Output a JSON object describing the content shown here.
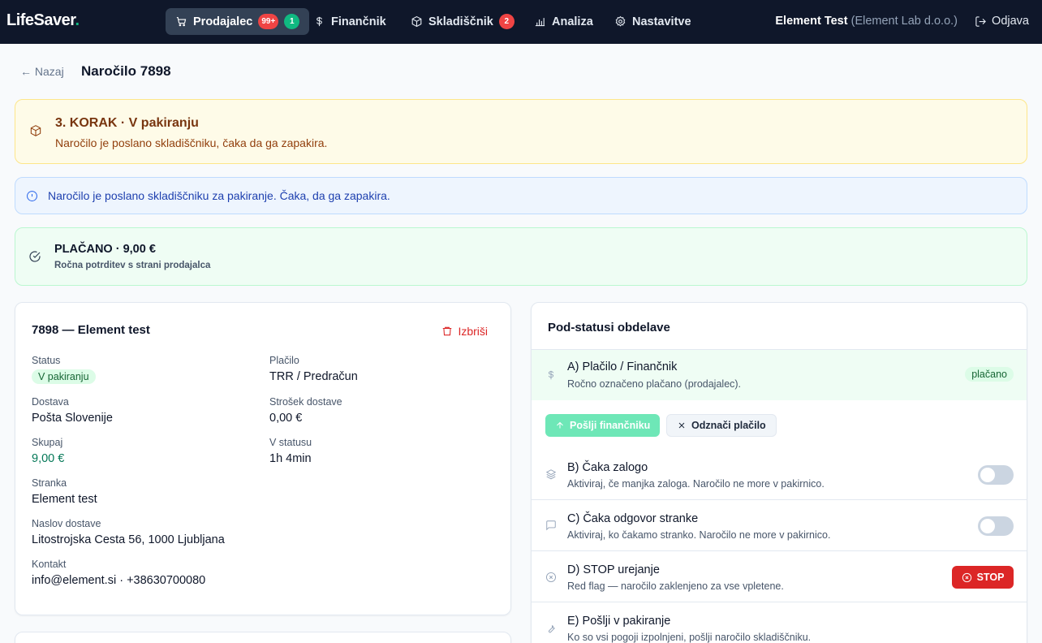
{
  "app": {
    "logo": "LifeSaver",
    "logo_dot": "."
  },
  "nav": {
    "items": [
      {
        "label": "Prodajalec",
        "badge_red": "99+",
        "badge_green": "1"
      },
      {
        "label": "Finančnik"
      },
      {
        "label": "Skladiščnik",
        "badge_red": "2"
      },
      {
        "label": "Analiza"
      },
      {
        "label": "Nastavitve"
      }
    ],
    "user": "Element Test",
    "org": "(Element Lab d.o.o.)",
    "logout": "Odjava"
  },
  "header": {
    "back": "← Nazaj",
    "title": "Naročilo 7898"
  },
  "step_banner": {
    "title": "3. KORAK · V pakiranju",
    "subtitle": "Naročilo je poslano skladiščniku, čaka da ga zapakira."
  },
  "info_banner": {
    "text": "Naročilo je poslano skladiščniku za pakiranje. Čaka, da ga zapakira."
  },
  "paid_banner": {
    "title": "PLAČANO · 9,00 €",
    "subtitle": "Ročna potrditev s strani prodajalca"
  },
  "order": {
    "heading": "7898 — Element test",
    "delete": "Izbriši",
    "status_label": "Status",
    "status_value": "V pakiranju",
    "payment_label": "Plačilo",
    "payment_value": "TRR / Predračun",
    "delivery_label": "Dostava",
    "delivery_value": "Pošta Slovenije",
    "delivery_cost_label": "Strošek dostave",
    "delivery_cost_value": "0,00 €",
    "total_label": "Skupaj",
    "total_value": "9,00 €",
    "in_status_label": "V statusu",
    "in_status_value": "1h 4min",
    "customer_label": "Stranka",
    "customer_value": "Element test",
    "address_label": "Naslov dostave",
    "address_value": "Litostrojska Cesta 56, 1000 Ljubljana",
    "contact_label": "Kontakt",
    "contact_value": "info@element.si · +38630700080"
  },
  "substatus": {
    "heading": "Pod-statusi obdelave",
    "a": {
      "title": "A) Plačilo / Finančnik",
      "subtitle": "Ročno označeno plačano (prodajalec).",
      "pill": "plačano",
      "send_btn": "Pošlji finančniku",
      "unmark_btn": "Odznači plačilo"
    },
    "b": {
      "title": "B) Čaka zalogo",
      "subtitle": "Aktiviraj, če manjka zaloga. Naročilo ne more v pakirnico."
    },
    "c": {
      "title": "C) Čaka odgovor stranke",
      "subtitle": "Aktiviraj, ko čakamo stranko. Naročilo ne more v pakirnico."
    },
    "d": {
      "title": "D) STOP urejanje",
      "subtitle": "Red flag — naročilo zaklenjeno za vse vpletene.",
      "btn": "STOP"
    },
    "e": {
      "title": "E) Pošlji v pakiranje",
      "subtitle": "Ko so vsi pogoji izpolnjeni, pošlji naročilo skladiščniku."
    }
  },
  "icons": [
    "cart-icon",
    "dollar-icon",
    "box-icon",
    "chart-icon",
    "gear-icon",
    "logout-icon",
    "info-icon",
    "check-circle-icon",
    "trash-icon",
    "layers-icon",
    "message-icon",
    "x-circle-icon",
    "wrench-icon",
    "arrow-up-icon",
    "x-icon"
  ],
  "colors": {
    "nav_bg": "#0f172a",
    "accent_green": "#10b981",
    "danger": "#dc2626"
  }
}
